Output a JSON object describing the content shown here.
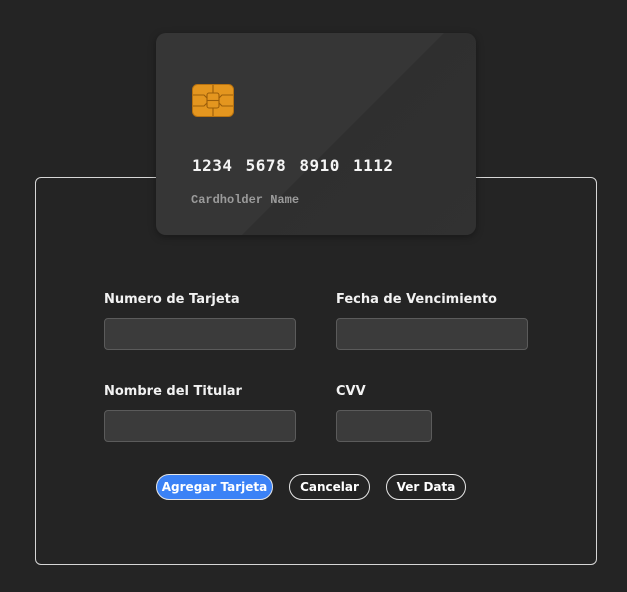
{
  "card_preview": {
    "number": "1234  5678  8910  1112",
    "holder_placeholder": "Cardholder Name",
    "chip_icon": "card-chip-icon",
    "chip_color": "#e4961f"
  },
  "form": {
    "card_number_label": "Numero de Tarjeta",
    "card_number_value": "",
    "expiry_label": "Fecha de Vencimiento",
    "expiry_value": "",
    "holder_label": "Nombre del Titular",
    "holder_value": "",
    "cvv_label": "CVV",
    "cvv_value": ""
  },
  "actions": {
    "add_label": "Agregar Tarjeta",
    "cancel_label": "Cancelar",
    "view_label": "Ver Data"
  },
  "colors": {
    "background": "#242424",
    "primary": "#3b82f6",
    "border": "#d6d6d6"
  }
}
